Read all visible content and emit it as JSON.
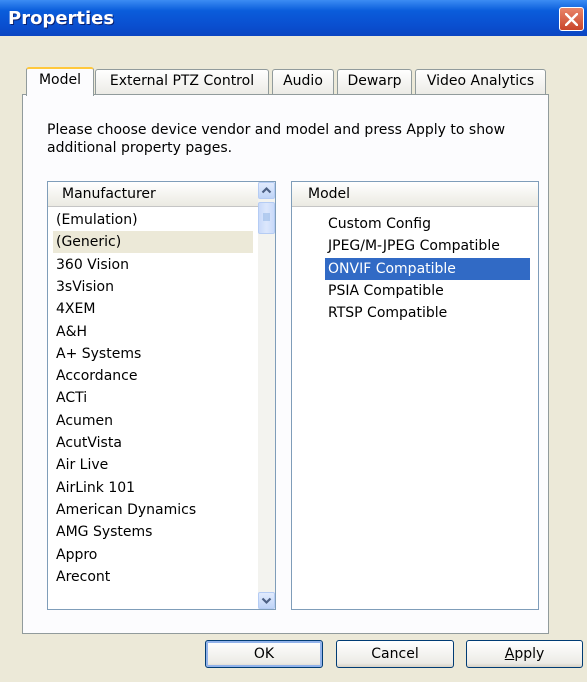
{
  "window": {
    "title": "Properties"
  },
  "tabs": [
    {
      "label": "Model",
      "active": true
    },
    {
      "label": "External PTZ Control",
      "active": false
    },
    {
      "label": "Audio",
      "active": false
    },
    {
      "label": "Dewarp",
      "active": false
    },
    {
      "label": "Video Analytics",
      "active": false
    }
  ],
  "instructions": "Please choose device vendor and model and press Apply to show additional property pages.",
  "manufacturer_list": {
    "header": "Manufacturer",
    "selected": "(Generic)",
    "items": [
      "(Emulation)",
      "(Generic)",
      "360 Vision",
      "3sVision",
      "4XEM",
      "A&H",
      "A+ Systems",
      "Accordance",
      "ACTi",
      "Acumen",
      "AcutVista",
      "Air Live",
      "AirLink 101",
      "American Dynamics",
      "AMG Systems",
      "Appro",
      "Arecont"
    ]
  },
  "model_list": {
    "header": "Model",
    "selected": "ONVIF Compatible",
    "items": [
      "Custom Config",
      "JPEG/M-JPEG Compatible",
      "ONVIF Compatible",
      "PSIA Compatible",
      "RTSP Compatible"
    ]
  },
  "buttons": {
    "ok": "OK",
    "cancel": "Cancel",
    "apply_underlined": "A",
    "apply_rest": "pply"
  },
  "colors": {
    "titlebar": "#0A5DDB",
    "selection": "#316AC5",
    "dialog_bg": "#ECE9D8"
  }
}
